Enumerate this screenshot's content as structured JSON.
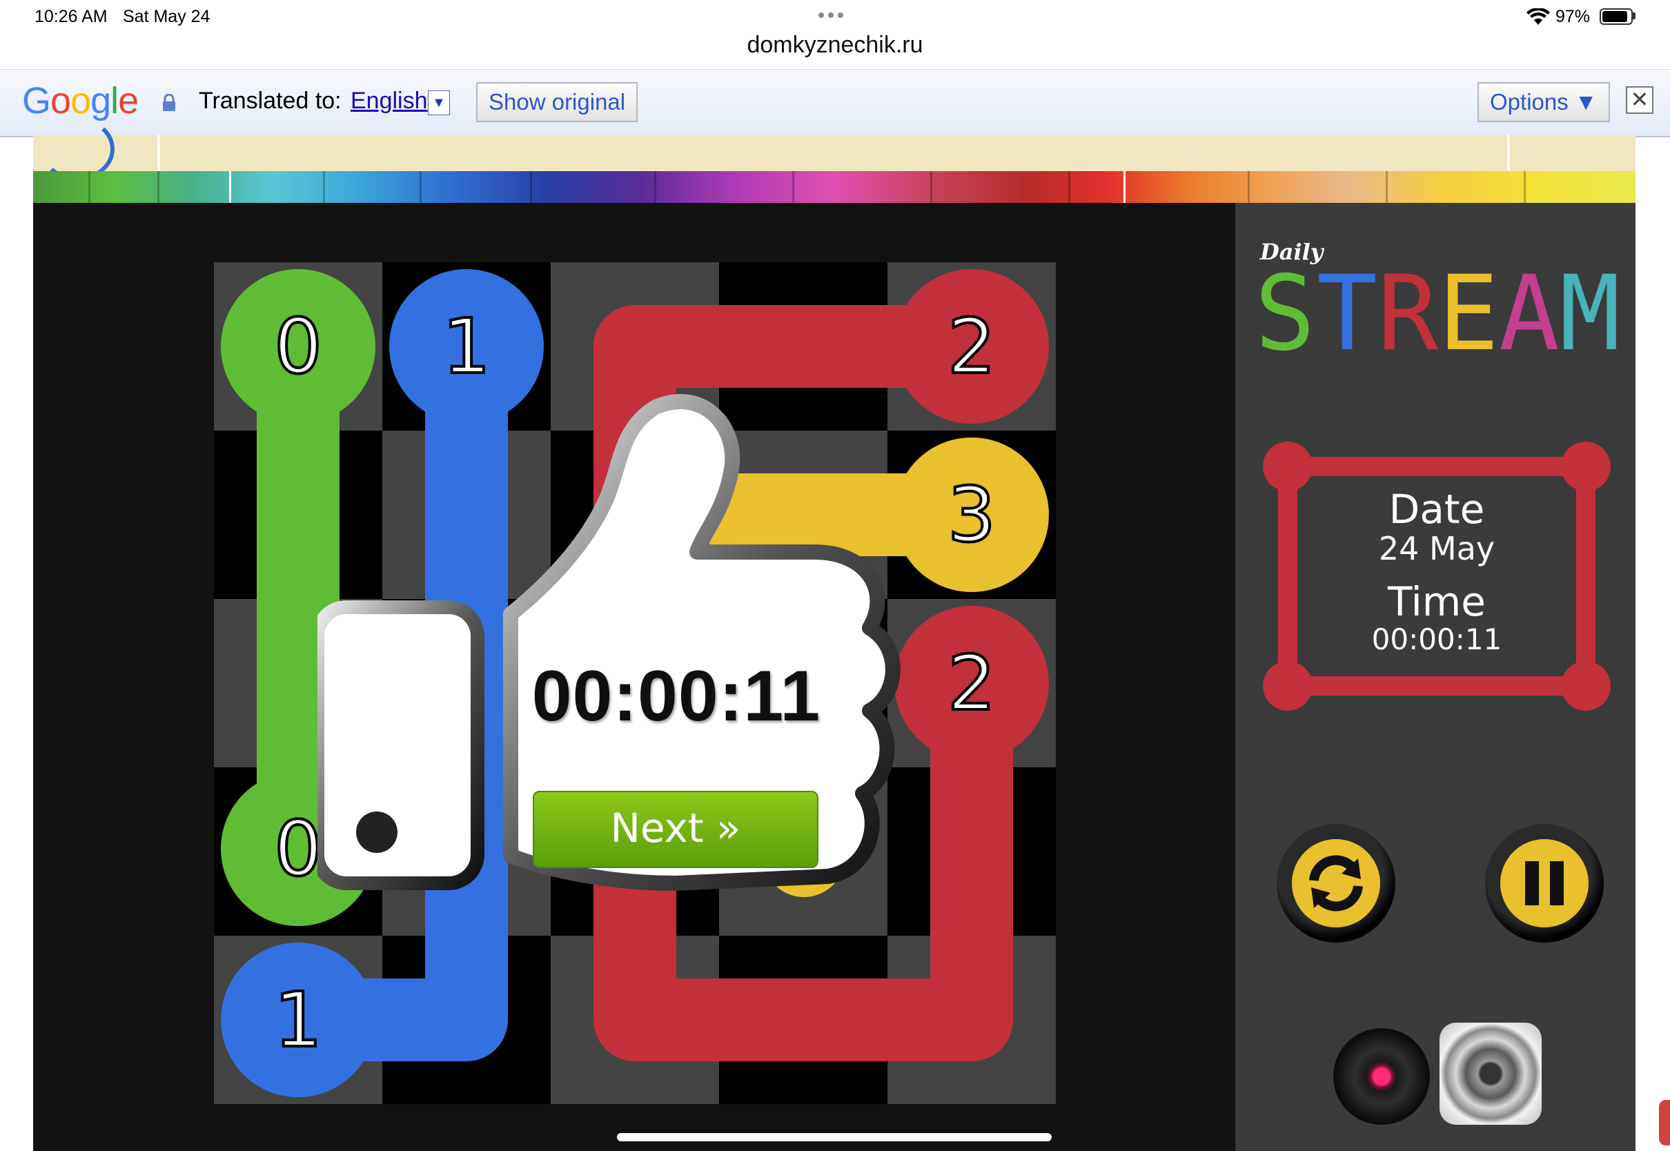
{
  "status_bar": {
    "time": "10:26 AM",
    "date": "Sat May 24",
    "url": "domkyznechik.ru",
    "battery": "97%"
  },
  "translate_bar": {
    "logo": "Google",
    "label": "Translated to:",
    "language": "English",
    "show_original": "Show original",
    "options": "Options ▼",
    "close": "✕"
  },
  "game": {
    "logo_daily": "Daily",
    "logo_title": "STREAM",
    "info": {
      "date_label": "Date",
      "date_value": "24 May",
      "time_label": "Time",
      "time_value": "00:00:11"
    },
    "popup": {
      "time": "00:00:11",
      "next_label": "Next »"
    },
    "buttons": {
      "refresh_icon": "refresh-icon",
      "pause_icon": "pause-icon",
      "record_icon": "record-icon",
      "speaker_icon": "speaker-icon"
    },
    "board": {
      "size": 5,
      "colors": {
        "green": "#5fbd35",
        "blue": "#3471e0",
        "red": "#c2303c",
        "yellow": "#e9c02d"
      },
      "endpoints": [
        {
          "row": 0,
          "col": 0,
          "label": "0",
          "color": "green"
        },
        {
          "row": 4,
          "col": 0,
          "label": "0",
          "color": "green"
        },
        {
          "row": 0,
          "col": 1,
          "label": "1",
          "color": "blue"
        },
        {
          "row": 5,
          "col": 0,
          "label": "1",
          "color": "blue"
        },
        {
          "row": 0,
          "col": 4,
          "label": "2",
          "color": "red"
        },
        {
          "row": 2,
          "col": 4,
          "label": "2",
          "color": "red"
        },
        {
          "row": 1,
          "col": 4,
          "label": "3",
          "color": "yellow"
        }
      ]
    }
  },
  "colors": {
    "game_bg": "#121212",
    "sidebar_bg": "#3b3b3b",
    "cell_dark": "#444444",
    "cell_black": "#000000",
    "accent_yellow": "#e9c02d",
    "next_green": "#7ab814"
  }
}
